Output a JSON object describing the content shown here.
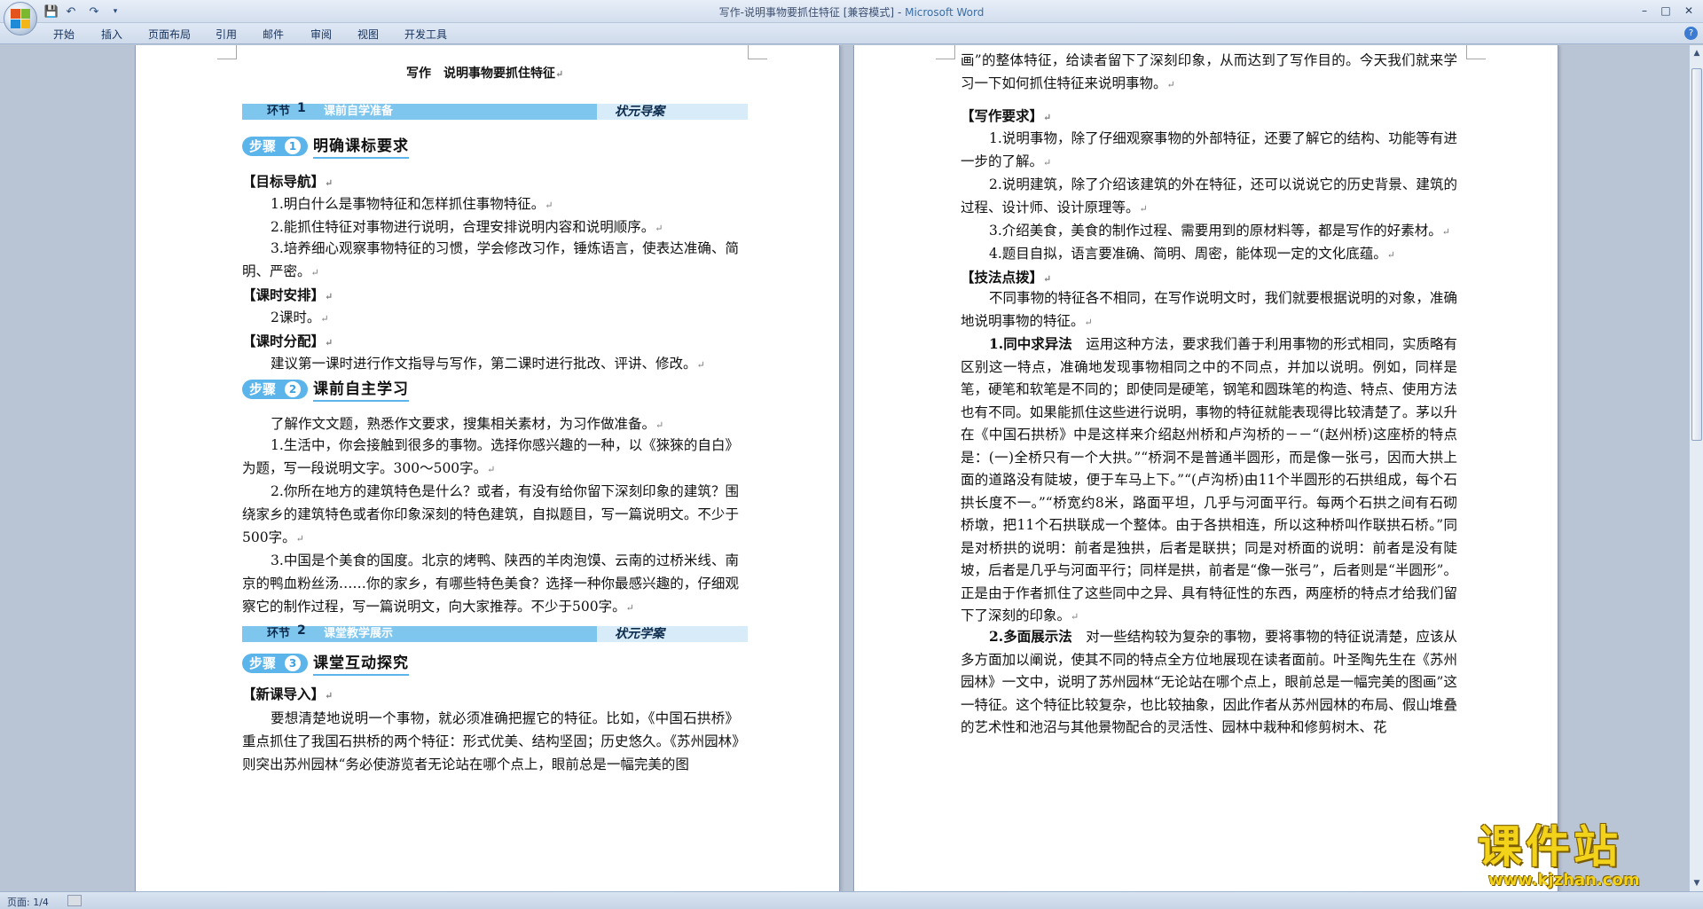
{
  "window": {
    "title": "写作-说明事物要抓住特征 [兼容模式]",
    "app_name": "Microsoft Word",
    "title_separator": " - "
  },
  "quick_access": [
    "save-icon",
    "undo-icon",
    "redo-icon",
    "customize-icon"
  ],
  "ribbon_tabs": [
    "开始",
    "插入",
    "页面布局",
    "引用",
    "邮件",
    "审阅",
    "视图",
    "开发工具"
  ],
  "status": {
    "page": "页面: 1/4"
  },
  "watermark": {
    "big": "课件站",
    "url": "www.kjzhan.com"
  },
  "pilcrow": "↵",
  "page1": {
    "doc_title": "写作　说明事物要抓住特征",
    "banner1": {
      "label": "环节",
      "num": "1",
      "sub": "课前自学准备",
      "right": "状元导案"
    },
    "step1": {
      "label": "步骤",
      "num": "1",
      "title": "明确课标要求"
    },
    "h_goal": "【目标导航】",
    "goal_1": "1.明白什么是事物特征和怎样抓住事物特征。",
    "goal_2": "2.能抓住特征对事物进行说明，合理安排说明内容和说明顺序。",
    "goal_3": "3.培养细心观察事物特征的习惯，学会修改习作，锤炼语言，使表达准确、简明、严密。",
    "h_hours": "【课时安排】",
    "hours": "2课时。",
    "h_alloc": "【课时分配】",
    "alloc": "建议第一课时进行作文指导与写作，第二课时进行批改、评讲、修改。",
    "step2": {
      "label": "步骤",
      "num": "2",
      "title": "课前自主学习"
    },
    "pre_intro": "了解作文文题，熟悉作文要求，搜集相关素材，为习作做准备。",
    "pre_1": "1.生活中，你会接触到很多的事物。选择你感兴趣的一种，以《猍猍的自白》为题，写一段说明文字。300～500字。",
    "pre_2": "2.你所在地方的建筑特色是什么？或者，有没有给你留下深刻印象的建筑？围绕家乡的建筑特色或者你印象深刻的特色建筑，自拟题目，写一篇说明文。不少于500字。",
    "pre_3": "3.中国是个美食的国度。北京的烤鸭、陕西的羊肉泡馍、云南的过桥米线、南京的鸭血粉丝汤……你的家乡，有哪些特色美食？选择一种你最感兴趣的，仔细观察它的制作过程，写一篇说明文，向大家推荐。不少于500字。",
    "banner2": {
      "label": "环节",
      "num": "2",
      "sub": "课堂教学展示",
      "right": "状元学案"
    },
    "step3": {
      "label": "步骤",
      "num": "3",
      "title": "课堂互动探究"
    },
    "h_new": "【新课导入】",
    "new_1": "要想清楚地说明一个事物，就必须准确把握它的特征。比如，《中国石拱桥》重点抓住了我国石拱桥的两个特征：形式优美、结构坚固；历史悠久。《苏州园林》则突出苏州园林“务必使游览者无论站在哪个点上，眼前总是一幅完美的图"
  },
  "page2": {
    "cont": "画”的整体特征，给读者留下了深刻印象，从而达到了写作目的。今天我们就来学习一下如何抓住特征来说明事物。",
    "h_req": "【写作要求】",
    "req_1": "1.说明事物，除了仔细观察事物的外部特征，还要了解它的结构、功能等有进一步的了解。",
    "req_2": "2.说明建筑，除了介绍该建筑的外在特征，还可以说说它的历史背景、建筑的过程、设计师、设计原理等。",
    "req_3": "3.介绍美食，美食的制作过程、需要用到的原材料等，都是写作的好素材。",
    "req_4": "4.题目自拟，语言要准确、简明、周密，能体现一定的文化底蕴。",
    "h_tech": "【技法点拨】",
    "tech_intro": "不同事物的特征各不相同，在写作说明文时，我们就要根据说明的对象，准确地说明事物的特征。",
    "tech_1_head": "1.同中求异法",
    "tech_1": "　运用这种方法，要求我们善于利用事物的形式相同，实质略有区别这一特点，准确地发现事物相同之中的不同点，并加以说明。例如，同样是笔，硬笔和软笔是不同的；即使同是硬笔，钢笔和圆珠笔的构造、特点、使用方法也有不同。如果能抓住这些进行说明，事物的特征就能表现得比较清楚了。茅以升在《中国石拱桥》中是这样来介绍赵州桥和卢沟桥的－－“(赵州桥)这座桥的特点是：(一)全桥只有一个大拱。”“桥洞不是普通半圆形，而是像一张弓，因而大拱上面的道路没有陡坡，便于车马上下。”“(卢沟桥)由11个半圆形的石拱组成，每个石拱长度不一。”“桥宽约8米，路面平坦，几乎与河面平行。每两个石拱之间有石砌桥墩，把11个石拱联成一个整体。由于各拱相连，所以这种桥叫作联拱石桥。”同是对桥拱的说明：前者是独拱，后者是联拱；同是对桥面的说明：前者是没有陡坡，后者是几乎与河面平行；同样是拱，前者是“像一张弓”，后者则是“半圆形”。正是由于作者抓住了这些同中之异、具有特征性的东西，两座桥的特点才给我们留下了深刻的印象。",
    "tech_2_head": "2.多面展示法",
    "tech_2": "　对一些结构较为复杂的事物，要将事物的特征说清楚，应该从多方面加以阐说，使其不同的特点全方位地展现在读者面前。叶圣陶先生在《苏州园林》一文中，说明了苏州园林“无论站在哪个点上，眼前总是一幅完美的图画”这一特征。这个特征比较复杂，也比较抽象，因此作者从苏州园林的布局、假山堆叠的艺术性和池沼与其他景物配合的灵活性、园林中栽种和修剪树木、花"
  }
}
